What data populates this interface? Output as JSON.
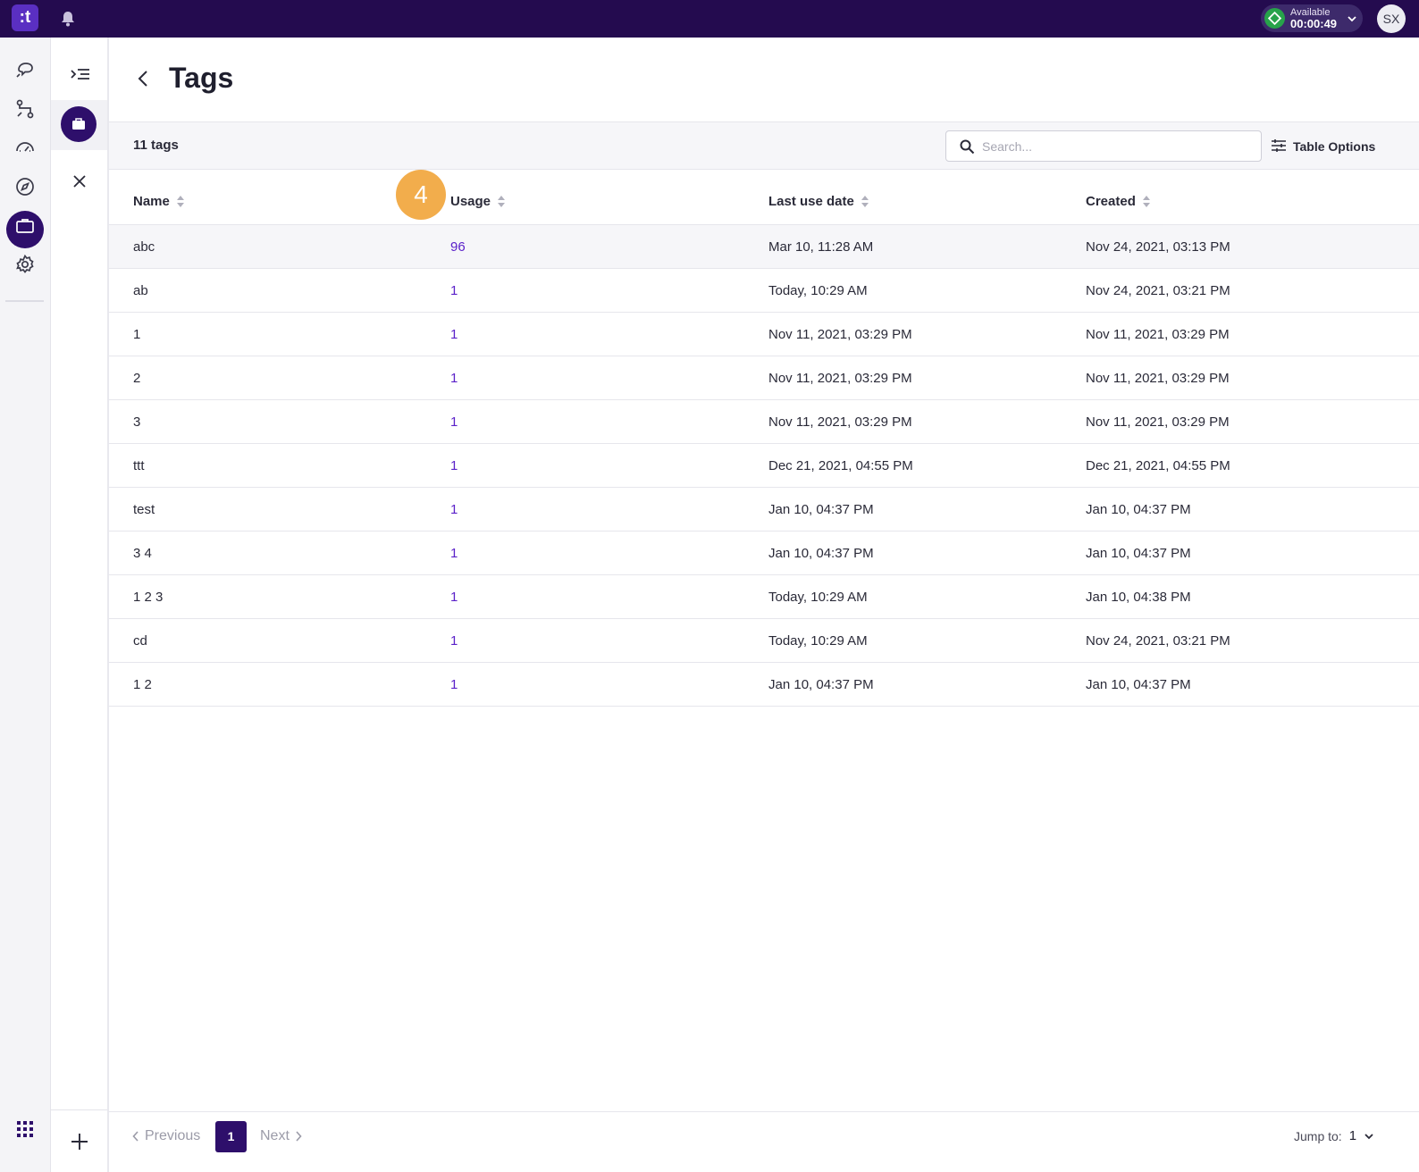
{
  "app": {
    "logo_text": ":t",
    "status": {
      "label": "Available",
      "timer": "00:00:49",
      "color": "#27a34a"
    },
    "user_initials": "SX"
  },
  "page": {
    "title": "Tags",
    "count_label": "11 tags",
    "search_placeholder": "Search...",
    "table_options_label": "Table Options",
    "step_badge": "4"
  },
  "table": {
    "headers": [
      "Name",
      "Usage",
      "Last use date",
      "Created"
    ],
    "rows": [
      {
        "name": "abc",
        "usage": "96",
        "last_use": "Mar 10, 11:28 AM",
        "created": "Nov 24, 2021, 03:13 PM"
      },
      {
        "name": "ab",
        "usage": "1",
        "last_use": "Today, 10:29 AM",
        "created": "Nov 24, 2021, 03:21 PM"
      },
      {
        "name": "1",
        "usage": "1",
        "last_use": "Nov 11, 2021, 03:29 PM",
        "created": "Nov 11, 2021, 03:29 PM"
      },
      {
        "name": "2",
        "usage": "1",
        "last_use": "Nov 11, 2021, 03:29 PM",
        "created": "Nov 11, 2021, 03:29 PM"
      },
      {
        "name": "3",
        "usage": "1",
        "last_use": "Nov 11, 2021, 03:29 PM",
        "created": "Nov 11, 2021, 03:29 PM"
      },
      {
        "name": "ttt",
        "usage": "1",
        "last_use": "Dec 21, 2021, 04:55 PM",
        "created": "Dec 21, 2021, 04:55 PM"
      },
      {
        "name": "test",
        "usage": "1",
        "last_use": "Jan 10, 04:37 PM",
        "created": "Jan 10, 04:37 PM"
      },
      {
        "name": "3 4",
        "usage": "1",
        "last_use": "Jan 10, 04:37 PM",
        "created": "Jan 10, 04:37 PM"
      },
      {
        "name": "1 2 3",
        "usage": "1",
        "last_use": "Today, 10:29 AM",
        "created": "Jan 10, 04:38 PM"
      },
      {
        "name": "cd",
        "usage": "1",
        "last_use": "Today, 10:29 AM",
        "created": "Nov 24, 2021, 03:21 PM"
      },
      {
        "name": "1 2",
        "usage": "1",
        "last_use": "Jan 10, 04:37 PM",
        "created": "Jan 10, 04:37 PM"
      }
    ]
  },
  "pagination": {
    "previous_label": "Previous",
    "current_page": "1",
    "next_label": "Next",
    "jump_label": "Jump to:",
    "jump_value": "1"
  },
  "colors": {
    "topbar": "#240b4f",
    "accent": "#2e0f6b",
    "link": "#5b21c9",
    "badge": "#f2ad4c"
  },
  "icons": {
    "topbar": [
      "bell-icon",
      "chevron-down-icon"
    ],
    "rail": [
      "chat-icon",
      "flow-icon",
      "speedometer-icon",
      "compass-icon",
      "briefcase-icon",
      "gear-icon",
      "apps-grid-icon"
    ],
    "subnav": [
      "collapse-menu-icon",
      "briefcase-icon",
      "close-icon",
      "plus-icon"
    ]
  }
}
